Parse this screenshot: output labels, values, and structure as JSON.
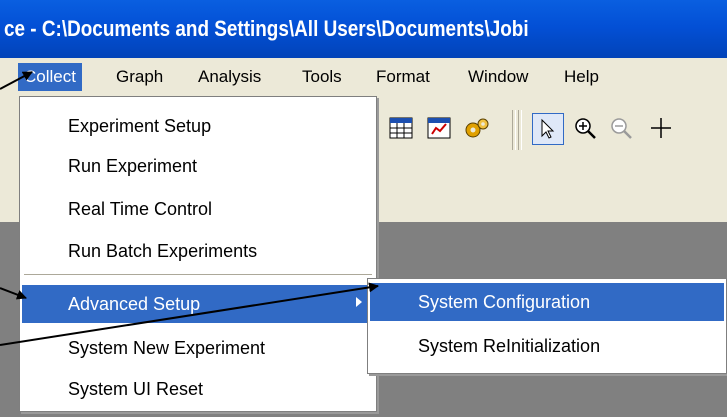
{
  "window": {
    "title": "ce - C:\\Documents and Settings\\All Users\\Documents\\Jobi"
  },
  "menubar": {
    "items": [
      {
        "label": "Collect"
      },
      {
        "label": "Graph"
      },
      {
        "label": "Analysis"
      },
      {
        "label": "Tools"
      },
      {
        "label": "Format"
      },
      {
        "label": "Window"
      },
      {
        "label": "Help"
      }
    ]
  },
  "toolbar": {
    "icons": [
      "table-icon",
      "edit-chart-icon",
      "settings-gear-icon",
      "pointer-icon",
      "zoom-in-icon",
      "zoom-out-icon",
      "crosshair-icon"
    ]
  },
  "collect_menu": {
    "items": [
      {
        "label": "Experiment Setup"
      },
      {
        "label": "Run Experiment"
      },
      {
        "label": "Real Time Control"
      },
      {
        "label": "Run Batch Experiments"
      },
      {
        "label": "Advanced Setup"
      },
      {
        "label": "System New Experiment"
      },
      {
        "label": "System UI Reset"
      }
    ]
  },
  "advanced_submenu": {
    "items": [
      {
        "label": "System Configuration"
      },
      {
        "label": "System ReInitialization"
      }
    ]
  },
  "colors": {
    "highlight": "#316ac5",
    "menubar_bg": "#ece9d8",
    "titlebar": "#0350d6",
    "workspace": "#808080"
  }
}
